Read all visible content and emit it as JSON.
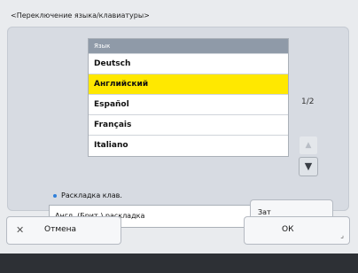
{
  "dialog": {
    "title": "<Переключение языка/клавиатуры>"
  },
  "language_list": {
    "header": "Язык",
    "items": [
      "Deutsch",
      "Английский",
      "Español",
      "Français",
      "Italiano"
    ],
    "selected": "Английский"
  },
  "pager": {
    "text": "1/2"
  },
  "keyboard": {
    "label": "Раскладка клав.",
    "value": "Англ. (Брит.) раскладка",
    "button_label": "Зат"
  },
  "buttons": {
    "cancel": "Отмена",
    "ok": "ОК"
  },
  "icons": {
    "cancel": "close-icon",
    "scroll_up": "up-arrow-icon",
    "scroll_down": "down-arrow-icon"
  },
  "colors": {
    "selected_row": "#ffe800",
    "list_header": "#8f9aa8",
    "footer": "#2d3035"
  }
}
